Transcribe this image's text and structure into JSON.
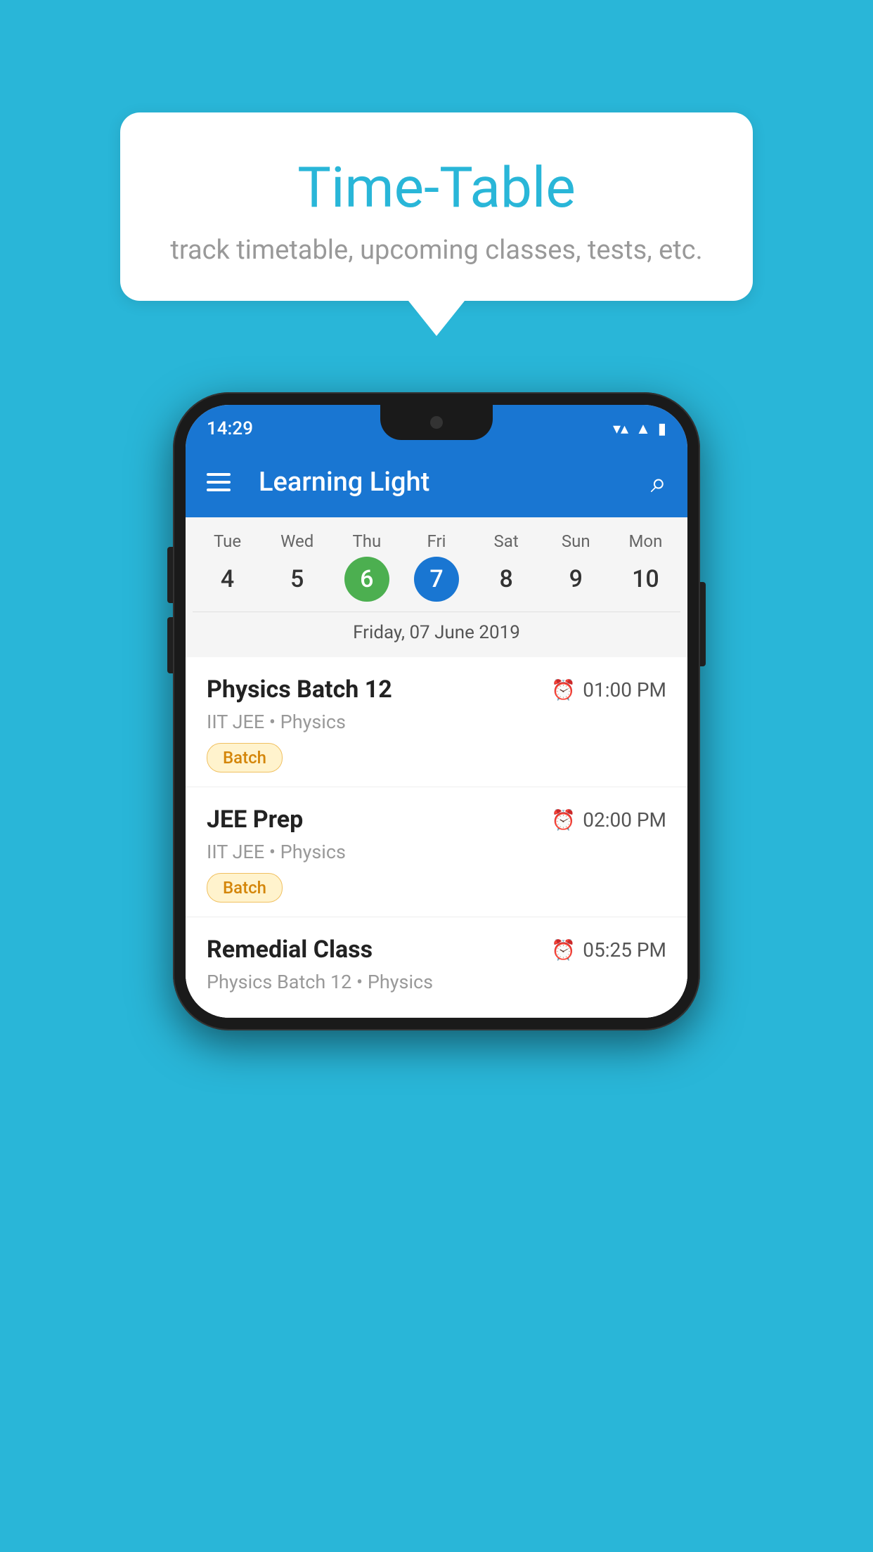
{
  "background": {
    "color": "#29B6D8"
  },
  "speech_bubble": {
    "title": "Time-Table",
    "subtitle": "track timetable, upcoming classes, tests, etc."
  },
  "phone": {
    "status_bar": {
      "time": "14:29"
    },
    "app_bar": {
      "title": "Learning Light"
    },
    "calendar": {
      "days": [
        {
          "label": "Tue",
          "number": "4",
          "state": "normal"
        },
        {
          "label": "Wed",
          "number": "5",
          "state": "normal"
        },
        {
          "label": "Thu",
          "number": "6",
          "state": "today"
        },
        {
          "label": "Fri",
          "number": "7",
          "state": "selected"
        },
        {
          "label": "Sat",
          "number": "8",
          "state": "normal"
        },
        {
          "label": "Sun",
          "number": "9",
          "state": "normal"
        },
        {
          "label": "Mon",
          "number": "10",
          "state": "normal"
        }
      ],
      "selected_date_label": "Friday, 07 June 2019"
    },
    "schedule": [
      {
        "title": "Physics Batch 12",
        "time": "01:00 PM",
        "subtitle": "IIT JEE • Physics",
        "tag": "Batch"
      },
      {
        "title": "JEE Prep",
        "time": "02:00 PM",
        "subtitle": "IIT JEE • Physics",
        "tag": "Batch"
      },
      {
        "title": "Remedial Class",
        "time": "05:25 PM",
        "subtitle": "Physics Batch 12 • Physics",
        "tag": ""
      }
    ]
  }
}
